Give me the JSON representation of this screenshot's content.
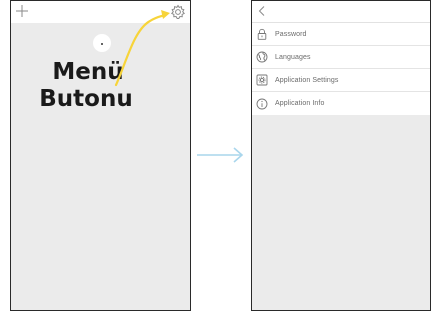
{
  "annotation": {
    "line1": "Menü",
    "line2": "Butonu"
  },
  "colors": {
    "highlight_yellow": "#f7d43a",
    "arrow_blue": "#a9d6ec",
    "screen_bg": "#ebebeb"
  },
  "left_screen": {
    "icons": [
      "plus-icon",
      "gear-icon"
    ]
  },
  "right_screen": {
    "icons": [
      "back-icon"
    ],
    "menu": [
      {
        "label": "Password",
        "icon": "lock-icon"
      },
      {
        "label": "Languages",
        "icon": "globe-icon"
      },
      {
        "label": "Application Settings",
        "icon": "settings-box-icon"
      },
      {
        "label": "Application Info",
        "icon": "info-icon"
      }
    ]
  }
}
